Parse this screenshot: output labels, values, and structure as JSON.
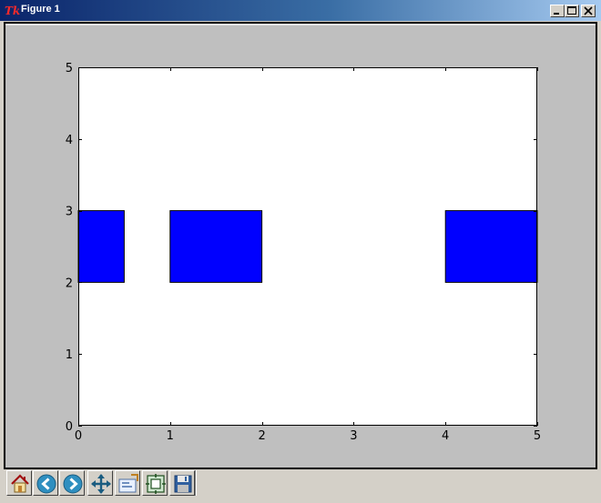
{
  "window": {
    "title": "Figure 1",
    "app_icon": "tk-feather-icon",
    "app_icon_text": "Tk",
    "controls": [
      "minimize-icon",
      "maximize-icon",
      "close-icon"
    ]
  },
  "toolbar": {
    "buttons": [
      {
        "name": "home-button",
        "icon": "home-icon"
      },
      {
        "name": "back-button",
        "icon": "back-arrow-icon"
      },
      {
        "name": "forward-button",
        "icon": "forward-arrow-icon"
      },
      {
        "name": "pan-button",
        "icon": "pan-arrows-icon"
      },
      {
        "name": "zoom-button",
        "icon": "zoom-rectangle-icon"
      },
      {
        "name": "subplots-button",
        "icon": "subplots-icon"
      },
      {
        "name": "save-button",
        "icon": "save-disk-icon"
      }
    ]
  },
  "colors": {
    "bar_fill": "#0000ff",
    "canvas_background": "#bfbfbf",
    "axes_background": "#ffffff"
  },
  "chart_data": {
    "type": "bar",
    "title": "",
    "xlabel": "",
    "ylabel": "",
    "xlim": [
      0,
      5
    ],
    "ylim": [
      0,
      5
    ],
    "xticks": [
      "0",
      "1",
      "2",
      "3",
      "4",
      "5"
    ],
    "yticks": [
      "0",
      "1",
      "2",
      "3",
      "4",
      "5"
    ],
    "grid": false,
    "series": [
      {
        "bars": [
          {
            "x_start": 0,
            "x_end": 0.5,
            "y_start": 2,
            "y_end": 3
          },
          {
            "x_start": 1,
            "x_end": 2,
            "y_start": 2,
            "y_end": 3
          },
          {
            "x_start": 4,
            "x_end": 5,
            "y_start": 2,
            "y_end": 3
          }
        ]
      }
    ]
  }
}
